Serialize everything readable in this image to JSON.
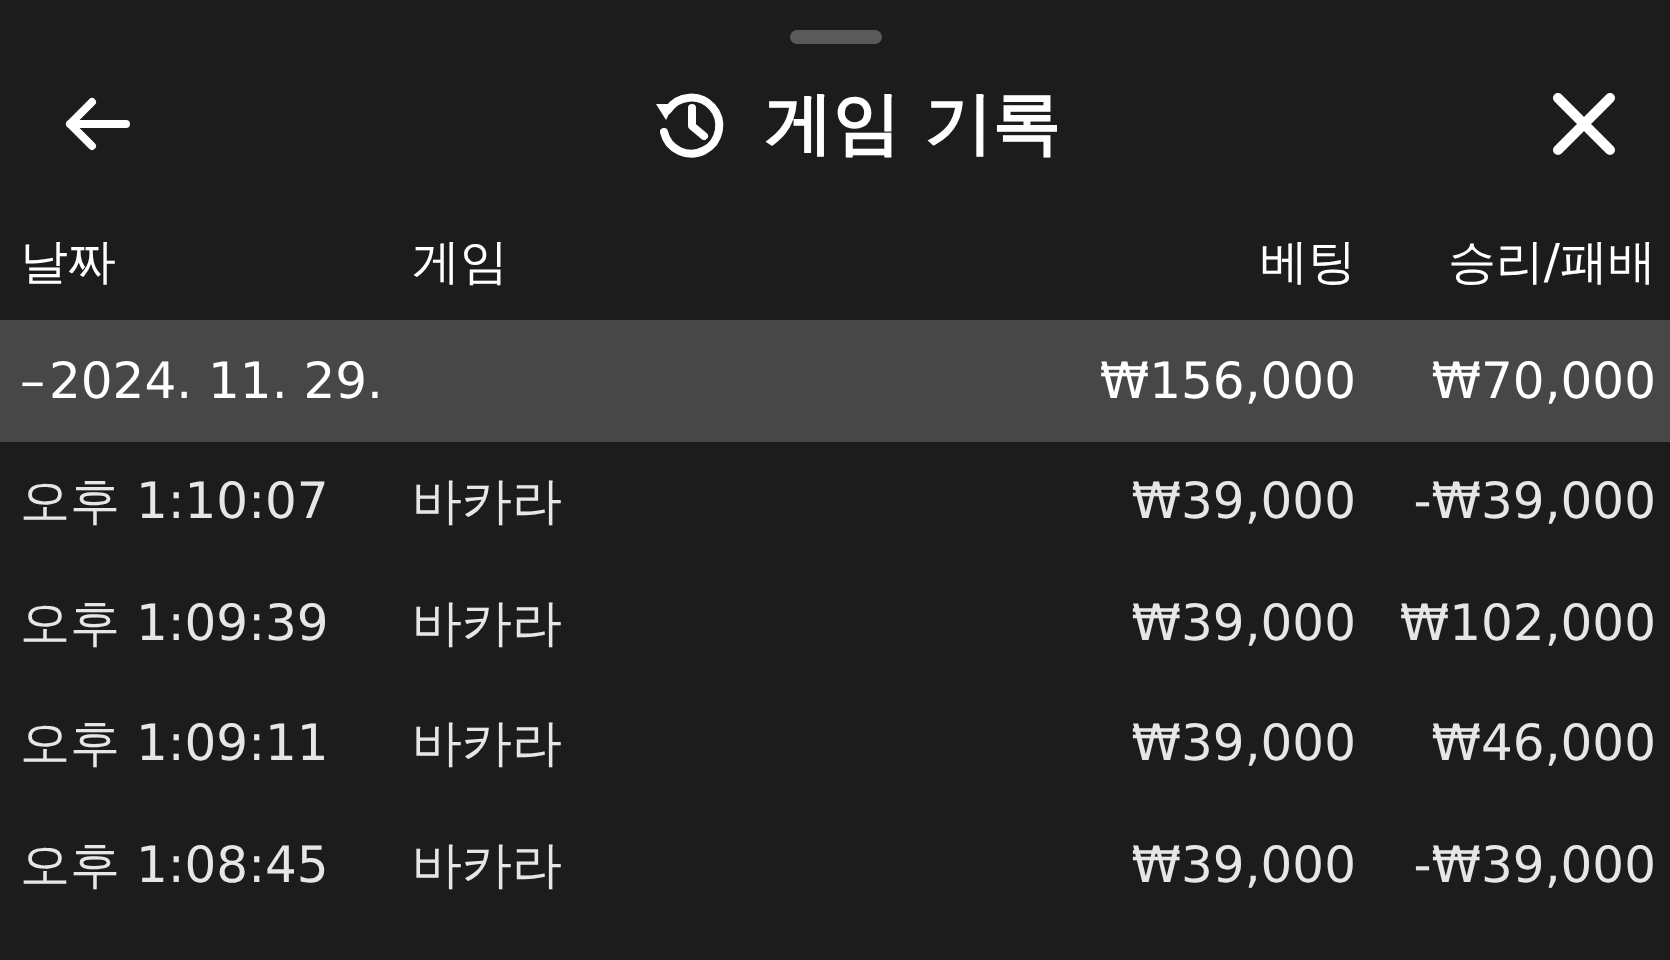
{
  "header": {
    "title": "게임 기록"
  },
  "table": {
    "columns": [
      "날짜",
      "게임",
      "베팅",
      "승리/패배"
    ],
    "group": {
      "toggle": "–",
      "date": "2024. 11. 29.",
      "bet": "₩156,000",
      "result": "₩70,000",
      "expanded": true
    },
    "rows": [
      {
        "time": "오후 1:10:07",
        "game": "바카라",
        "bet": "₩39,000",
        "result": "-₩39,000"
      },
      {
        "time": "오후 1:09:39",
        "game": "바카라",
        "bet": "₩39,000",
        "result": "₩102,000"
      },
      {
        "time": "오후 1:09:11",
        "game": "바카라",
        "bet": "₩39,000",
        "result": "₩46,000"
      },
      {
        "time": "오후 1:08:45",
        "game": "바카라",
        "bet": "₩39,000",
        "result": "-₩39,000"
      }
    ]
  }
}
